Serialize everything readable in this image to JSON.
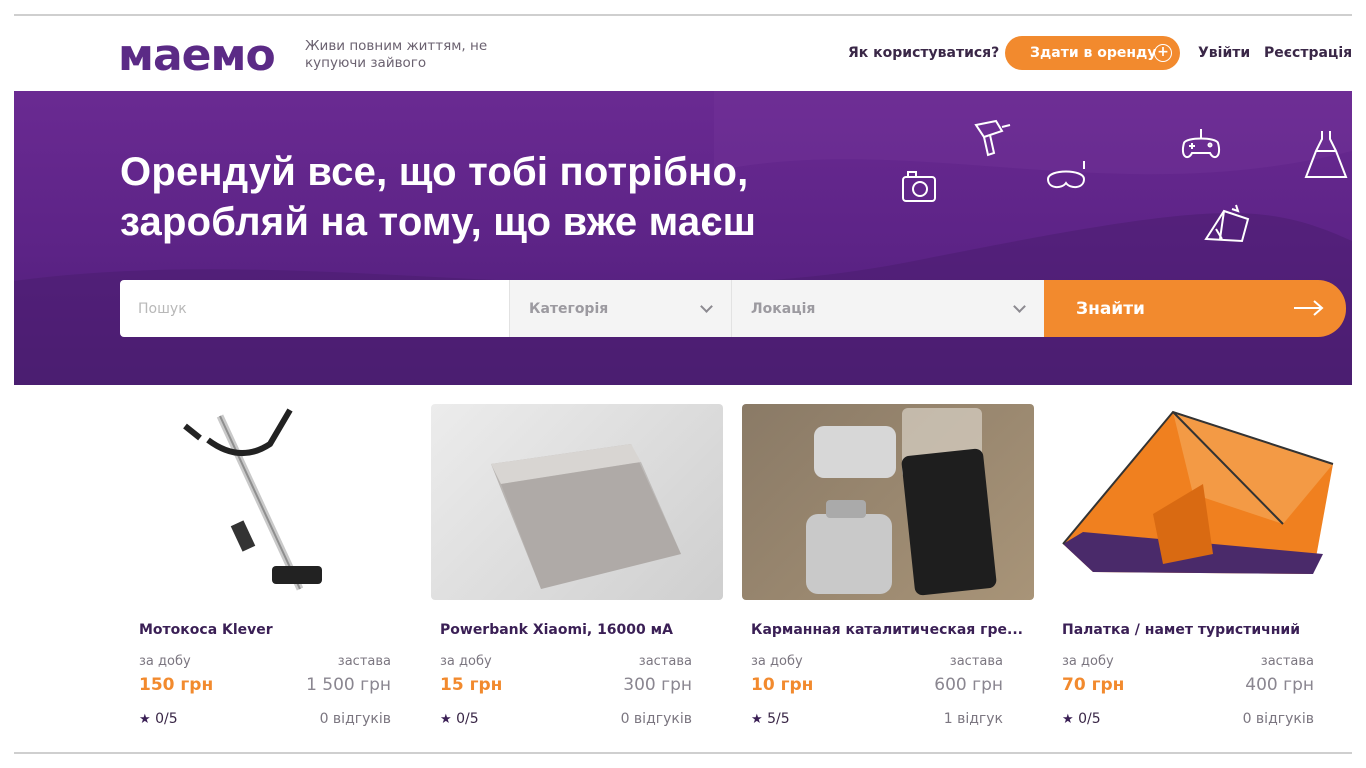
{
  "header": {
    "logo": "маемо",
    "tagline": "Живи повним життям, не купуючи зайвого",
    "how_to": "Як користуватися?",
    "rent_out": "Здати в оренду",
    "login": "Увійти",
    "register": "Реєстрація"
  },
  "hero": {
    "title_line1": "Орендуй все, що тобі потрібно,",
    "title_line2": "заробляй на тому, що вже маєш",
    "icons": [
      "drill-icon",
      "camera-icon",
      "diving-mask-icon",
      "gamepad-icon",
      "dress-icon",
      "tent-icon"
    ]
  },
  "search": {
    "placeholder": "Пошук",
    "category": "Категорія",
    "location": "Локація",
    "button": "Знайти"
  },
  "colors": {
    "brand": "#5b2a86",
    "accent": "#f28a2e"
  },
  "cards": [
    {
      "title": "Мотокоса Klever",
      "per_day_label": "за добу",
      "deposit_label": "застава",
      "price": "150 грн",
      "deposit": "1 500 грн",
      "rating": "0/5",
      "reviews": "0 відгуків"
    },
    {
      "title": "Powerbank Xiaomi, 16000 мА",
      "per_day_label": "за добу",
      "deposit_label": "застава",
      "price": "15 грн",
      "deposit": "300 грн",
      "rating": "0/5",
      "reviews": "0 відгуків"
    },
    {
      "title": "Карманная каталитическая гре...",
      "per_day_label": "за добу",
      "deposit_label": "застава",
      "price": "10 грн",
      "deposit": "600 грн",
      "rating": "5/5",
      "reviews": "1 відгук"
    },
    {
      "title": "Палатка / намет туристичний",
      "per_day_label": "за добу",
      "deposit_label": "застава",
      "price": "70 грн",
      "deposit": "400 грн",
      "rating": "0/5",
      "reviews": "0 відгуків"
    }
  ]
}
